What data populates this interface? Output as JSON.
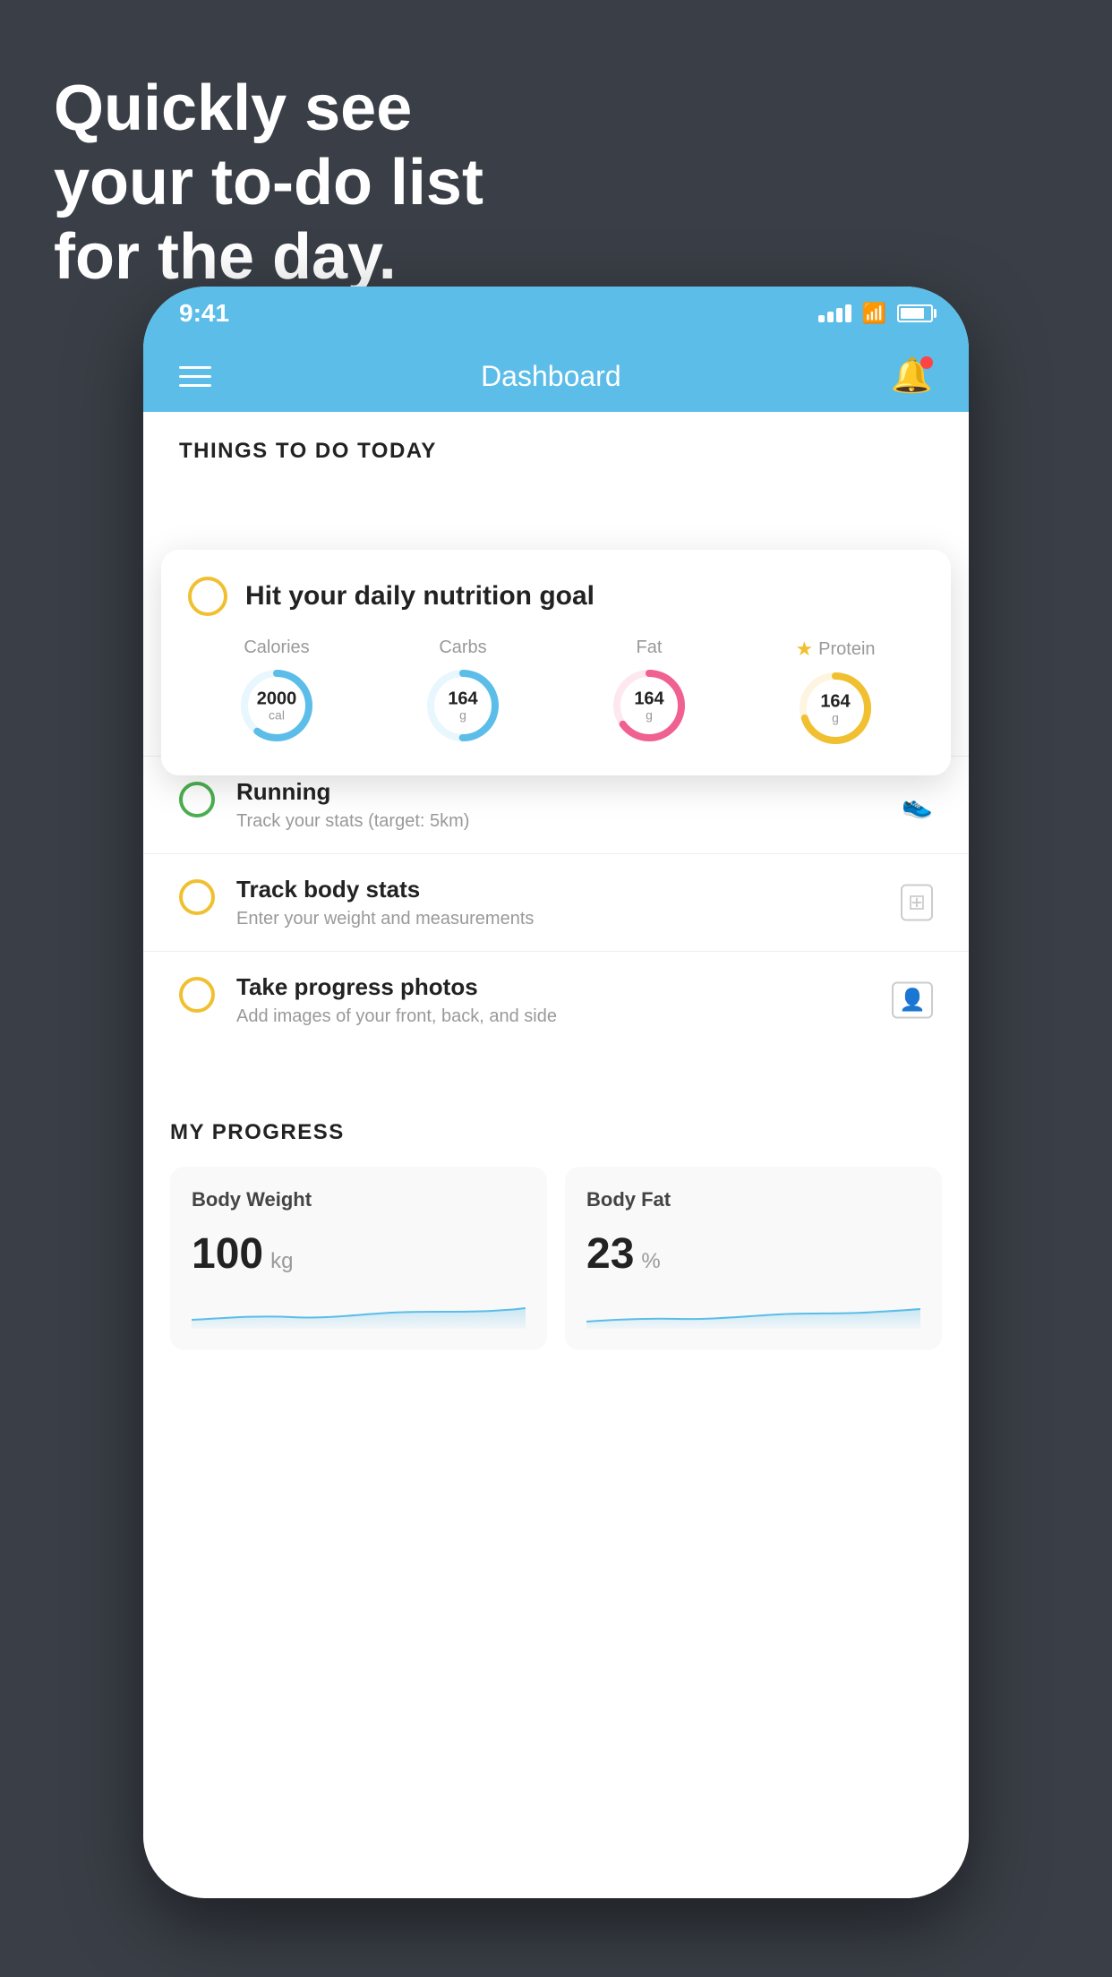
{
  "headline": {
    "line1": "Quickly see",
    "line2": "your to-do list",
    "line3": "for the day."
  },
  "status_bar": {
    "time": "9:41"
  },
  "nav": {
    "title": "Dashboard"
  },
  "things_today": {
    "section_title": "THINGS TO DO TODAY"
  },
  "nutrition_card": {
    "main_label": "Hit your daily nutrition goal",
    "macros": [
      {
        "label": "Calories",
        "value": "2000",
        "unit": "cal",
        "color": "#5bbde8",
        "track_color": "#e8f6fd",
        "percent": 60,
        "star": false
      },
      {
        "label": "Carbs",
        "value": "164",
        "unit": "g",
        "color": "#5bbde8",
        "track_color": "#e8f6fd",
        "percent": 50,
        "star": false
      },
      {
        "label": "Fat",
        "value": "164",
        "unit": "g",
        "color": "#f06090",
        "track_color": "#fde8ef",
        "percent": 65,
        "star": false
      },
      {
        "label": "Protein",
        "value": "164",
        "unit": "g",
        "color": "#f0c030",
        "track_color": "#fdf5e0",
        "percent": 70,
        "star": true
      }
    ]
  },
  "todo_items": [
    {
      "title": "Running",
      "subtitle": "Track your stats (target: 5km)",
      "circle_color": "green",
      "icon": "👟"
    },
    {
      "title": "Track body stats",
      "subtitle": "Enter your weight and measurements",
      "circle_color": "yellow",
      "icon": "⊞"
    },
    {
      "title": "Take progress photos",
      "subtitle": "Add images of your front, back, and side",
      "circle_color": "yellow",
      "icon": "👤"
    }
  ],
  "progress": {
    "section_title": "MY PROGRESS",
    "cards": [
      {
        "title": "Body Weight",
        "value": "100",
        "unit": "kg"
      },
      {
        "title": "Body Fat",
        "value": "23",
        "unit": "%"
      }
    ]
  }
}
